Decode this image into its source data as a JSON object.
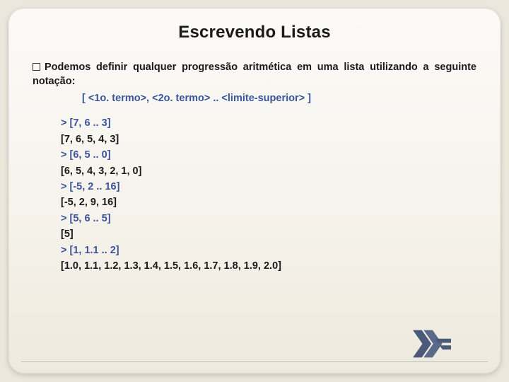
{
  "title": "Escrevendo Listas",
  "bullet": {
    "prefix": "Podemos definir qualquer progressão aritmética em uma lista utilizando a seguinte notação:",
    "notation": "[ <1o. termo>, <2o. termo> .. <limite-superior> ]"
  },
  "repl": [
    {
      "in": "> [7, 6 .. 3]",
      "out": "[7, 6, 5, 4, 3]"
    },
    {
      "in": "> [6, 5 .. 0]",
      "out": "[6, 5, 4, 3, 2, 1, 0]"
    },
    {
      "in": "> [-5, 2 .. 16]",
      "out": "[-5, 2, 9, 16]"
    },
    {
      "in": "> [5, 6 .. 5]",
      "out": "[5]"
    },
    {
      "in": "> [1, 1.1 .. 2]",
      "out": "[1.0, 1.1, 1.2, 1.3, 1.4, 1.5, 1.6, 1.7, 1.8, 1.9, 2.0]"
    }
  ],
  "logo_name": "haskell-logo"
}
